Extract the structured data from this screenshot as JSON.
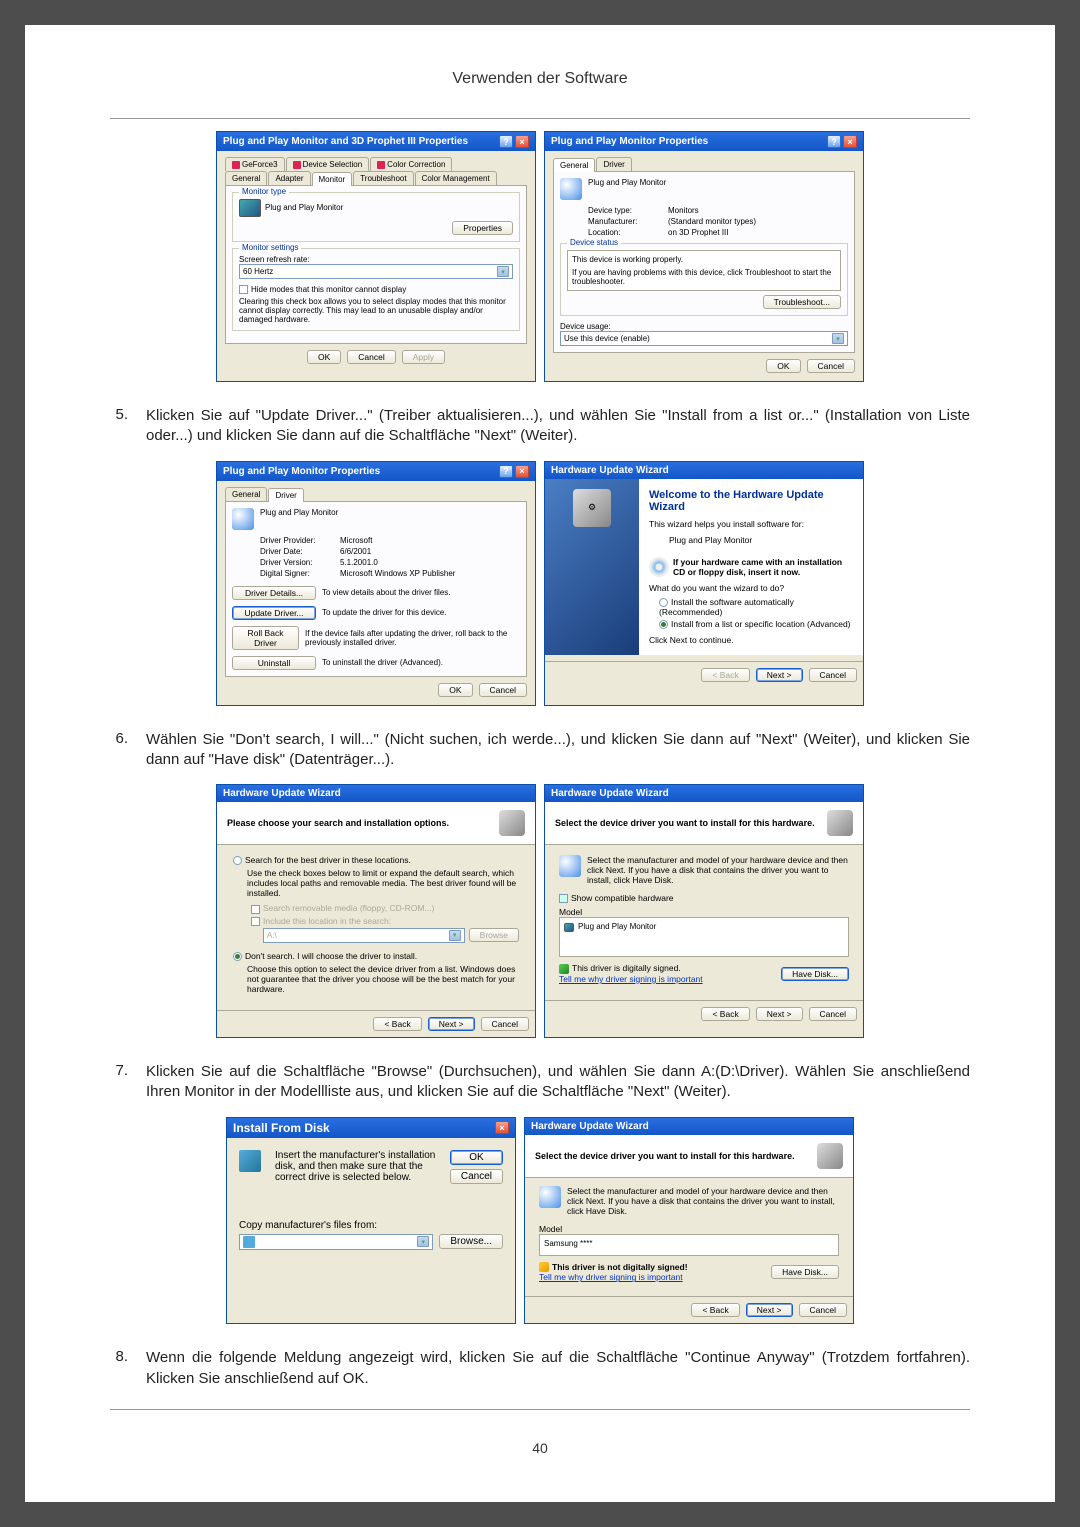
{
  "page": {
    "title": "Verwenden der Software",
    "number": "40"
  },
  "steps": {
    "s5": {
      "num": "5.",
      "text": "Klicken Sie auf \"Update Driver...\" (Treiber aktualisieren...), und wählen Sie \"Install from a list or...\" (Installation von Liste oder...) und klicken Sie dann auf die Schaltfläche \"Next\" (Weiter)."
    },
    "s6": {
      "num": "6.",
      "text": "Wählen Sie \"Don't search, I will...\" (Nicht suchen, ich werde...), und klicken Sie dann auf \"Next\" (Weiter), und klicken Sie dann auf \"Have disk\" (Datenträger...)."
    },
    "s7": {
      "num": "7.",
      "text": "Klicken Sie auf die Schaltfläche \"Browse\" (Durchsuchen), und wählen Sie dann A:(D:\\Driver). Wählen Sie anschließend Ihren Monitor in der Modellliste aus, und klicken Sie auf die Schaltfläche \"Next\" (Weiter)."
    },
    "s8": {
      "num": "8.",
      "text": "Wenn die folgende Meldung angezeigt wird, klicken Sie auf die Schaltfläche \"Continue Anyway\" (Trotzdem fortfahren). Klicken Sie anschließend auf OK."
    }
  },
  "dlg1": {
    "title": "Plug and Play Monitor and 3D Prophet III Properties",
    "tabs": {
      "geforce": "GeForce3",
      "device_sel": "Device Selection",
      "color_corr": "Color Correction",
      "general": "General",
      "adapter": "Adapter",
      "monitor": "Monitor",
      "troubleshoot": "Troubleshoot",
      "color_mgmt": "Color Management"
    },
    "monitor_type_legend": "Monitor type",
    "monitor_name": "Plug and Play Monitor",
    "properties_btn": "Properties",
    "monitor_settings_legend": "Monitor settings",
    "refresh_label": "Screen refresh rate:",
    "refresh_value": "60 Hertz",
    "hide_modes": "Hide modes that this monitor cannot display",
    "hide_modes_desc": "Clearing this check box allows you to select display modes that this monitor cannot display correctly. This may lead to an unusable display and/or damaged hardware.",
    "ok": "OK",
    "cancel": "Cancel",
    "apply": "Apply"
  },
  "dlg2": {
    "title": "Plug and Play Monitor Properties",
    "tabs": {
      "general": "General",
      "driver": "Driver"
    },
    "device_name": "Plug and Play Monitor",
    "device_type_l": "Device type:",
    "device_type_v": "Monitors",
    "manufacturer_l": "Manufacturer:",
    "manufacturer_v": "(Standard monitor types)",
    "location_l": "Location:",
    "location_v": "on 3D Prophet III",
    "status_legend": "Device status",
    "status_text": "This device is working properly.",
    "status_help": "If you are having problems with this device, click Troubleshoot to start the troubleshooter.",
    "troubleshoot_btn": "Troubleshoot...",
    "usage_label": "Device usage:",
    "usage_value": "Use this device (enable)",
    "ok": "OK",
    "cancel": "Cancel"
  },
  "dlg3": {
    "title": "Plug and Play Monitor Properties",
    "device_name": "Plug and Play Monitor",
    "tabs": {
      "general": "General",
      "driver": "Driver"
    },
    "provider_l": "Driver Provider:",
    "provider_v": "Microsoft",
    "date_l": "Driver Date:",
    "date_v": "6/6/2001",
    "version_l": "Driver Version:",
    "version_v": "5.1.2001.0",
    "signer_l": "Digital Signer:",
    "signer_v": "Microsoft Windows XP Publisher",
    "details_btn": "Driver Details...",
    "details_txt": "To view details about the driver files.",
    "update_btn": "Update Driver...",
    "update_txt": "To update the driver for this device.",
    "rollback_btn": "Roll Back Driver",
    "rollback_txt": "If the device fails after updating the driver, roll back to the previously installed driver.",
    "uninstall_btn": "Uninstall",
    "uninstall_txt": "To uninstall the driver (Advanced).",
    "ok": "OK",
    "cancel": "Cancel"
  },
  "dlg4": {
    "title": "Hardware Update Wizard",
    "heading": "Welcome to the Hardware Update Wizard",
    "intro": "This wizard helps you install software for:",
    "device": "Plug and Play Monitor",
    "cd_hint": "If your hardware came with an installation CD or floppy disk, insert it now.",
    "question": "What do you want the wizard to do?",
    "opt_auto": "Install the software automatically (Recommended)",
    "opt_list": "Install from a list or specific location (Advanced)",
    "continue_hint": "Click Next to continue.",
    "back": "< Back",
    "next": "Next >",
    "cancel": "Cancel"
  },
  "dlg5": {
    "title": "Hardware Update Wizard",
    "heading": "Please choose your search and installation options.",
    "opt_search": "Search for the best driver in these locations.",
    "opt_search_desc": "Use the check boxes below to limit or expand the default search, which includes local paths and removable media. The best driver found will be installed.",
    "chk_media": "Search removable media (floppy, CD-ROM...)",
    "chk_include": "Include this location in the search:",
    "path_value": "A:\\",
    "browse_btn": "Browse",
    "opt_dont": "Don't search. I will choose the driver to install.",
    "opt_dont_desc": "Choose this option to select the device driver from a list. Windows does not guarantee that the driver you choose will be the best match for your hardware.",
    "back": "< Back",
    "next": "Next >",
    "cancel": "Cancel"
  },
  "dlg6": {
    "title": "Hardware Update Wizard",
    "heading": "Select the device driver you want to install for this hardware.",
    "instr": "Select the manufacturer and model of your hardware device and then click Next. If you have a disk that contains the driver you want to install, click Have Disk.",
    "show_compat": "Show compatible hardware",
    "model_label": "Model",
    "model_item": "Plug and Play Monitor",
    "signed": "This driver is digitally signed.",
    "why_link": "Tell me why driver signing is important",
    "have_disk": "Have Disk...",
    "back": "< Back",
    "next": "Next >",
    "cancel": "Cancel"
  },
  "dlg7": {
    "title": "Install From Disk",
    "instr": "Insert the manufacturer's installation disk, and then make sure that the correct drive is selected below.",
    "ok": "OK",
    "cancel": "Cancel",
    "copy_label": "Copy manufacturer's files from:",
    "path": "",
    "browse": "Browse..."
  },
  "dlg8": {
    "title": "Hardware Update Wizard",
    "heading": "Select the device driver you want to install for this hardware.",
    "instr": "Select the manufacturer and model of your hardware device and then click Next. If you have a disk that contains the driver you want to install, click Have Disk.",
    "model_label": "Model",
    "model_item": "Samsung ****",
    "not_signed": "This driver is not digitally signed!",
    "why_link": "Tell me why driver signing is important",
    "have_disk": "Have Disk...",
    "back": "< Back",
    "next": "Next >",
    "cancel": "Cancel"
  }
}
